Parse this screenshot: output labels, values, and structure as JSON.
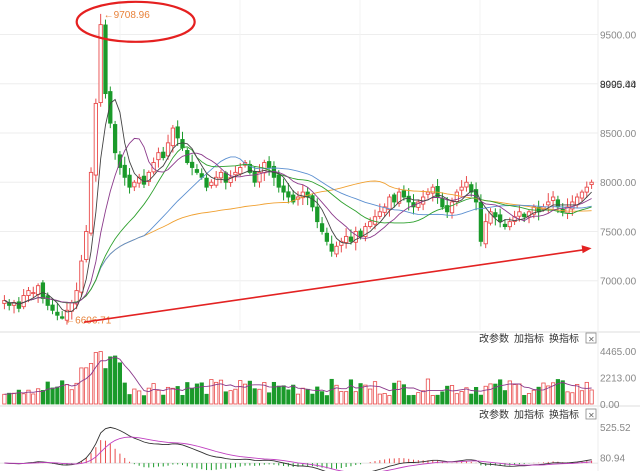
{
  "toolbar": {
    "modify_params": "改参数",
    "add_indicator": "加指标",
    "switch_indicator": "换指标",
    "close_symbol": "✕"
  },
  "chart_data": [
    {
      "type": "candlestick",
      "ylim": [
        6500,
        9850
      ],
      "y_ticks": [
        "9500.00",
        "9000.00",
        "8500.00",
        "8000.00",
        "7500.00",
        "7000.00"
      ],
      "y_tick_values": [
        9500,
        9000,
        8500,
        8000,
        7500,
        7000
      ],
      "current_price_label": "8995.44",
      "current_price": 8995.44,
      "high_annotation": "←9708.96",
      "high_value": 9708.96,
      "low_annotation": "←6606.71",
      "low_value": 6606.71,
      "colors": {
        "up": "#e94b4b",
        "down": "#1a9a2a"
      },
      "closes": [
        6800,
        6750,
        6780,
        6720,
        6850,
        6900,
        6880,
        6950,
        6820,
        6750,
        6700,
        6650,
        6620,
        6700,
        6780,
        6900,
        7200,
        7500,
        8100,
        8800,
        9600,
        8900,
        8600,
        8300,
        8150,
        8050,
        7950,
        8000,
        8050,
        7980,
        8100,
        8200,
        8300,
        8250,
        8400,
        8550,
        8450,
        8350,
        8200,
        8150,
        8100,
        8050,
        7950,
        8000,
        8050,
        8100,
        8000,
        8050,
        8100,
        8150,
        8200,
        8100,
        8000,
        8100,
        8200,
        8150,
        8050,
        7950,
        7900,
        7850,
        7800,
        7850,
        7900,
        7850,
        7750,
        7600,
        7500,
        7400,
        7300,
        7350,
        7400,
        7450,
        7400,
        7500,
        7450,
        7550,
        7600,
        7650,
        7700,
        7750,
        7850,
        7800,
        7900,
        7850,
        7800,
        7750,
        7800,
        7850,
        7900,
        7950,
        7850,
        7750,
        7700,
        7800,
        7900,
        7950,
        8000,
        7900,
        7800,
        7400,
        7600,
        7700,
        7650,
        7600,
        7550,
        7600,
        7650,
        7700,
        7650,
        7700,
        7750,
        7700,
        7750,
        7800,
        7850,
        7750,
        7700,
        7750,
        7800,
        7850,
        7900,
        7950,
        8000
      ],
      "ma_colors": [
        "#f0a030",
        "#5b8fd0",
        "#2da02d",
        "#8b3a8b",
        "#444444"
      ],
      "trend_arrow": {
        "from": [
          2,
          6600
        ],
        "to": [
          124,
          7330
        ],
        "color": "#e32222"
      },
      "circle": {
        "center_index": 20,
        "value": 9730
      }
    },
    {
      "type": "bar",
      "name": "volume",
      "y_ticks": [
        "4465.00",
        "2213.00",
        "0.00"
      ],
      "y_tick_values": [
        4465,
        2213,
        0
      ],
      "ylim": [
        0,
        4700
      ]
    },
    {
      "type": "line",
      "name": "macd",
      "y_ticks": [
        "525.52",
        "80.94"
      ],
      "y_tick_values": [
        525.52,
        80.94
      ],
      "ylim": [
        -100,
        600
      ]
    }
  ]
}
